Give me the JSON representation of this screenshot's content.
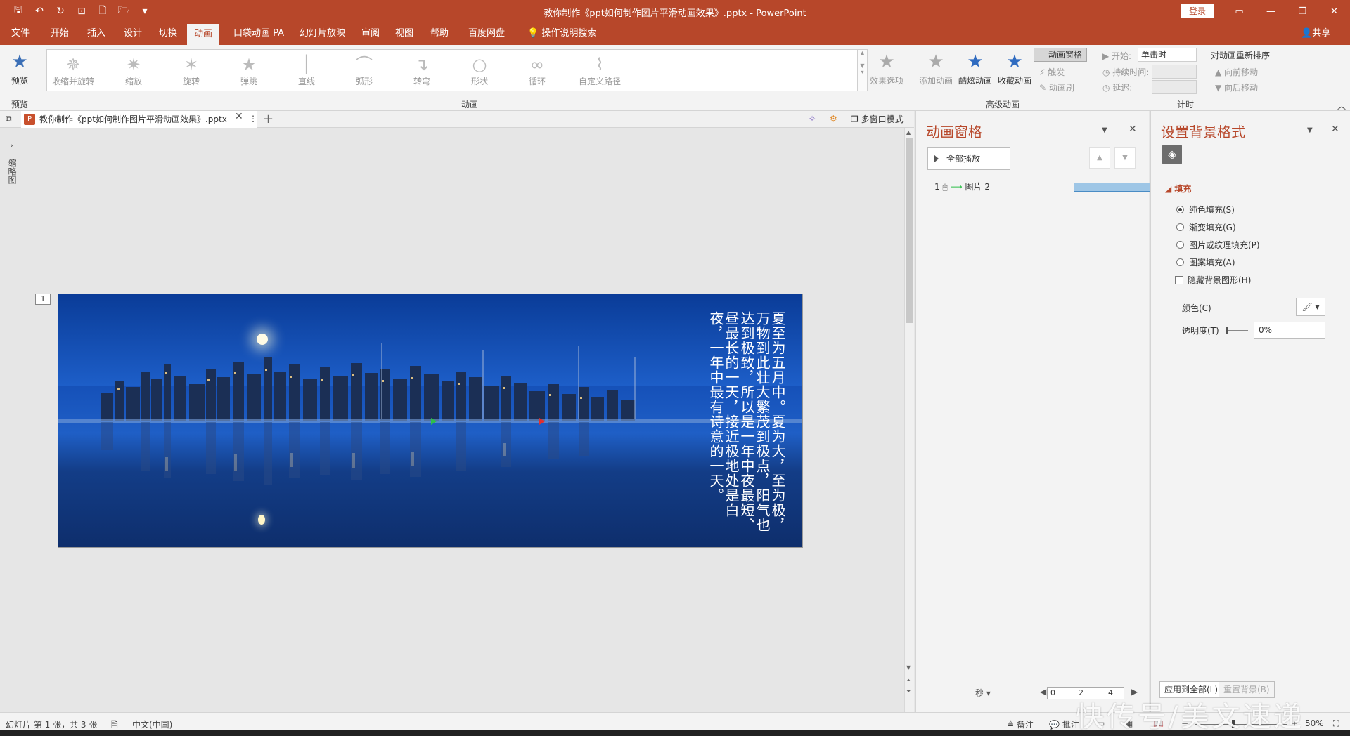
{
  "window": {
    "title": "教你制作《ppt如何制作图片平滑动画效果》.pptx - PowerPoint",
    "login_label": "登录"
  },
  "menu": {
    "items": [
      "文件",
      "开始",
      "插入",
      "设计",
      "切换",
      "动画",
      "口袋动画 PA",
      "幻灯片放映",
      "审阅",
      "视图",
      "帮助",
      "百度网盘",
      "操作说明搜索"
    ],
    "active": "动画",
    "share_label": "共享"
  },
  "ribbon": {
    "preview_label": "预览",
    "preview_group": "预览",
    "animation_items": [
      "收缩并旋转",
      "缩放",
      "旋转",
      "弹跳",
      "直线",
      "弧形",
      "转弯",
      "形状",
      "循环",
      "自定义路径"
    ],
    "effect_options": "效果选项",
    "animation_group": "动画",
    "add_animation": "添加动画",
    "cool_animation": "酷炫动画",
    "favorite_animation": "收藏动画",
    "animation_pane_btn": "动画窗格",
    "trigger": "触发",
    "animation_painter": "动画刷",
    "advanced_group": "高级动画",
    "start_label": "开始:",
    "start_value": "单击时",
    "duration_label": "持续时间:",
    "delay_label": "延迟:",
    "reorder_title": "对动画重新排序",
    "move_earlier": "向前移动",
    "move_later": "向后移动",
    "timing_group": "计时"
  },
  "tabs": {
    "doc_tab": "教你制作《ppt如何制作图片平滑动画效果》.pptx",
    "multi_window": "多窗口模式"
  },
  "thumbnails": {
    "label": "缩略图"
  },
  "slide": {
    "number": "1",
    "text": "夏至为五月中。夏为大，至为极，万物到此壮大繁茂到极点，阳气也达到极致，所以是一年中夜最短、昼最长的一天，接近极地处是白夜，一年中最有诗意的一天。"
  },
  "anim_pane": {
    "title": "动画窗格",
    "play_all": "全部播放",
    "item_index": "1",
    "item_name": "图片 2",
    "seconds_label": "秒",
    "scale": [
      "0",
      "2",
      "4"
    ]
  },
  "fmt_pane": {
    "title": "设置背景格式",
    "section": "填充",
    "options": [
      "纯色填充(S)",
      "渐变填充(G)",
      "图片或纹理填充(P)",
      "图案填充(A)"
    ],
    "selected_index": 0,
    "hide_bg": "隐藏背景图形(H)",
    "color_label": "颜色(C)",
    "transparency_label": "透明度(T)",
    "transparency_value": "0%",
    "apply_all": "应用到全部(L)",
    "reset_bg": "重置背景(B)"
  },
  "status": {
    "slide_info": "幻灯片 第 1 张，共 3 张",
    "language": "中文(中国)",
    "notes": "备注",
    "comments": "批注",
    "zoom": "50%"
  },
  "watermark": "快传号/美文速递",
  "colors": {
    "accent": "#b7472a",
    "anim_bar": "#9ec6e6"
  }
}
